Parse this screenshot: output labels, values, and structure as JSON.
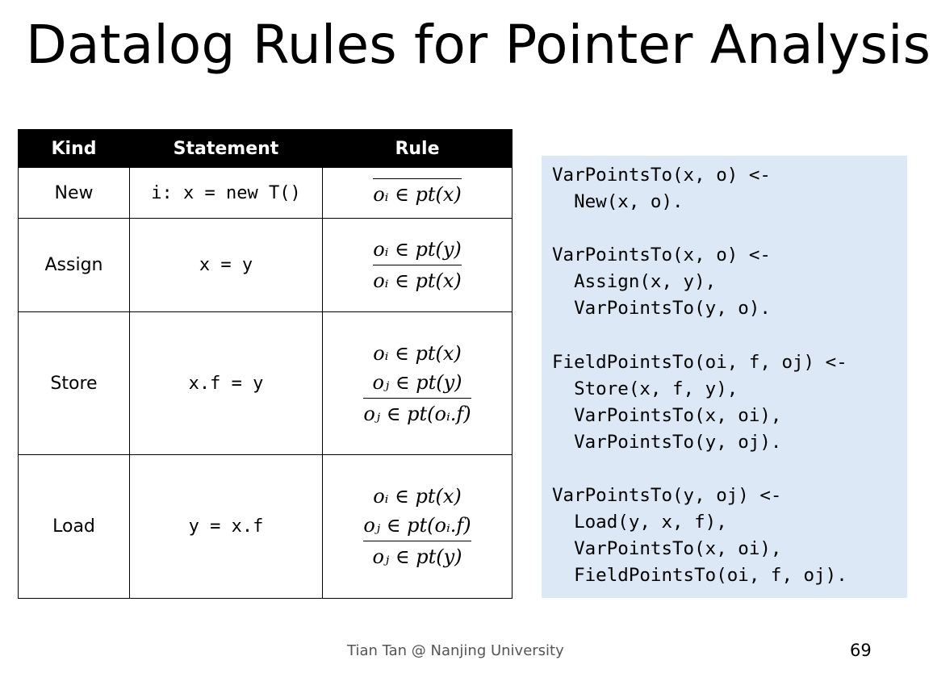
{
  "title": "Datalog Rules for Pointer Analysis",
  "table": {
    "headers": [
      "Kind",
      "Statement",
      "Rule"
    ],
    "rows": [
      {
        "kind": "New",
        "statement": "i: x = new T()",
        "premises": [],
        "conclusion": "oᵢ ∈ pt(x)"
      },
      {
        "kind": "Assign",
        "statement": "x = y",
        "premises": [
          "oᵢ ∈ pt(y)"
        ],
        "conclusion": "oᵢ ∈ pt(x)"
      },
      {
        "kind": "Store",
        "statement": "x.f = y",
        "premises": [
          "oᵢ ∈ pt(x)",
          "oⱼ ∈ pt(y)"
        ],
        "conclusion": "oⱼ ∈ pt(oᵢ.f)"
      },
      {
        "kind": "Load",
        "statement": "y = x.f",
        "premises": [
          "oᵢ ∈ pt(x)",
          "oⱼ ∈ pt(oᵢ.f)"
        ],
        "conclusion": "oⱼ ∈ pt(y)"
      }
    ]
  },
  "code_lines": [
    "VarPointsTo(x, o) <-",
    "  New(x, o).",
    "",
    "VarPointsTo(x, o) <-",
    "  Assign(x, y),",
    "  VarPointsTo(y, o).",
    "",
    "FieldPointsTo(oi, f, oj) <-",
    "  Store(x, f, y),",
    "  VarPointsTo(x, oi),",
    "  VarPointsTo(y, oj).",
    "",
    "VarPointsTo(y, oj) <-",
    "  Load(y, x, f),",
    "  VarPointsTo(x, oi),",
    "  FieldPointsTo(oi, f, oj)."
  ],
  "footer": "Tian Tan @ Nanjing University",
  "page_number": "69"
}
